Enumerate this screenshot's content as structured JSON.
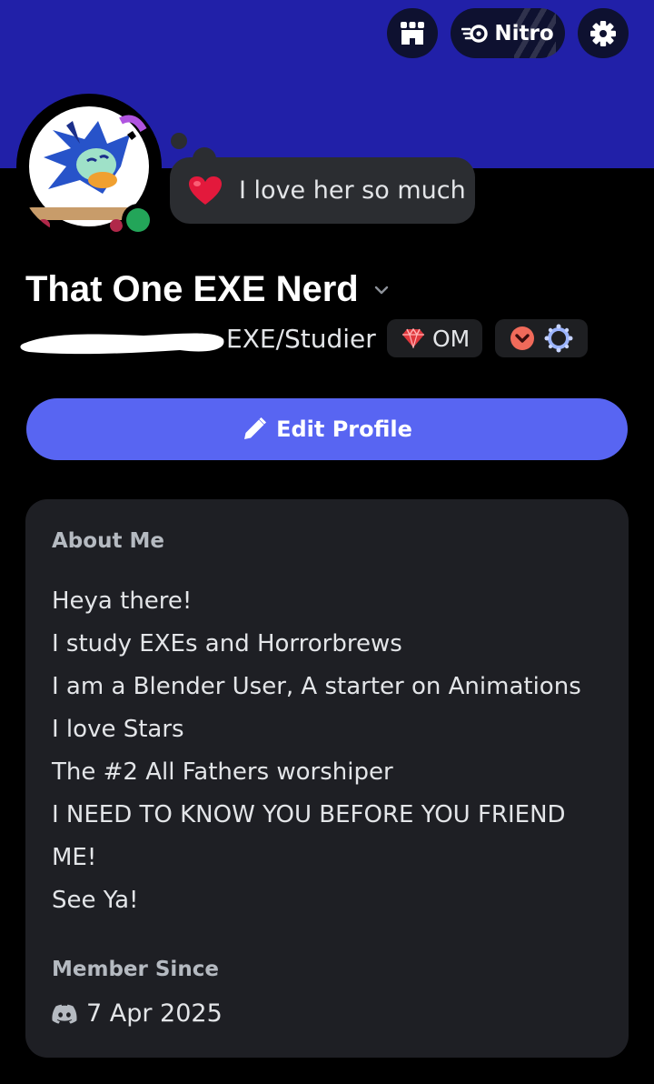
{
  "header": {
    "shop_icon": "shop-icon",
    "nitro_label": "Nitro",
    "settings_icon": "gear-icon",
    "banner_color": "#2120a8"
  },
  "profile": {
    "custom_status": "I love her so much",
    "status_emoji": "red-heart",
    "online_status_color": "#23a559",
    "display_name": "That One EXE Nerd",
    "pronouns": "EXE/Studier",
    "clan_tag": "OM",
    "edit_button": "Edit Profile"
  },
  "about": {
    "title": "About Me",
    "lines": [
      "Heya there!",
      "I study EXEs and Horrorbrews",
      "I am a Blender User, A starter on Animations",
      "I love Stars",
      "The #2 All Fathers worshiper",
      "I NEED TO KNOW YOU BEFORE YOU FRIEND",
      "ME!",
      "See Ya!"
    ]
  },
  "member_since": {
    "title": "Member Since",
    "date": "7 Apr 2025"
  },
  "colors": {
    "accent": "#5865f2",
    "card_bg": "#1e1f24"
  }
}
